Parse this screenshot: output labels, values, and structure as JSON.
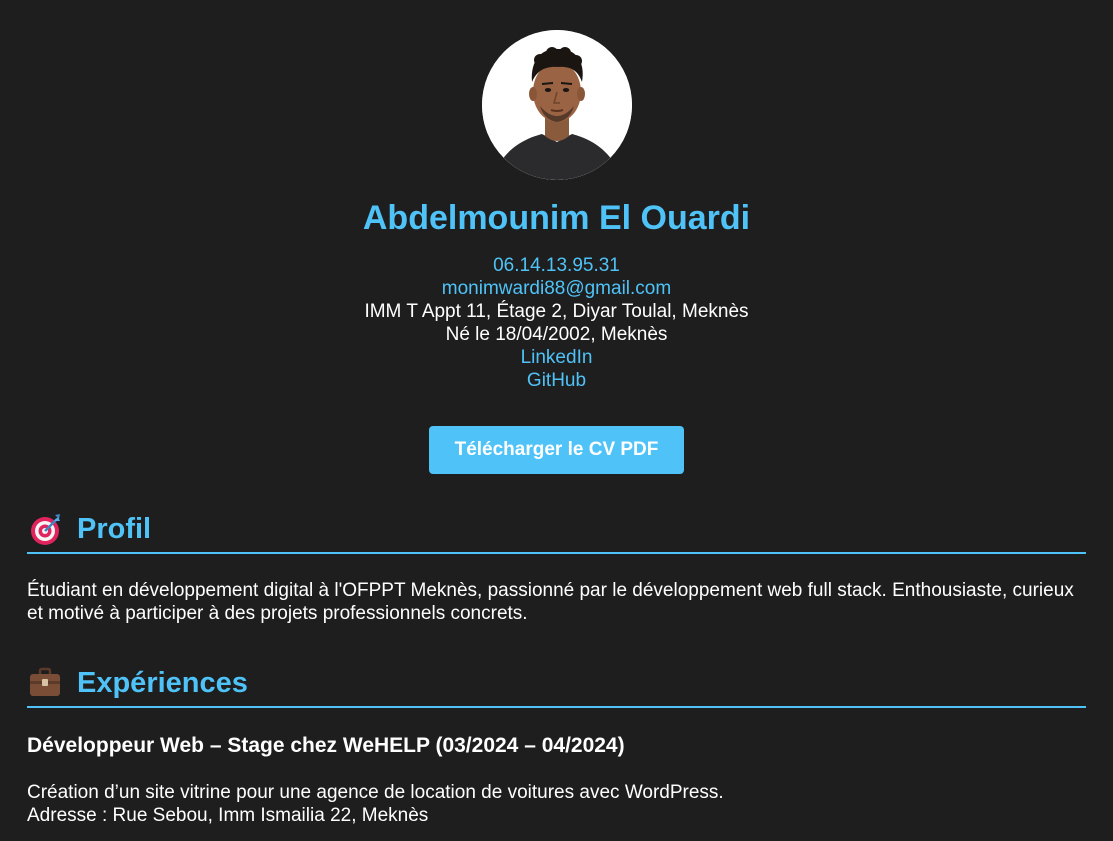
{
  "header": {
    "name": "Abdelmounim El Ouardi",
    "phone": "06.14.13.95.31",
    "email": "monimwardi88@gmail.com",
    "address": "IMM T Appt 11, Étage 2, Diyar Toulal, Meknès",
    "birth": "Né le 18/04/2002, Meknès",
    "linkedin": "LinkedIn",
    "github": "GitHub",
    "download_button": "Télécharger le CV PDF"
  },
  "profil": {
    "icon": "target-icon",
    "title": "Profil",
    "text": "Étudiant en développement digital à l'OFPPT Meknès, passionné par le développement web full stack. Enthousiaste, curieux et motivé à participer à des projets professionnels concrets."
  },
  "experiences": {
    "icon": "briefcase-icon",
    "title": "Expériences",
    "items": [
      {
        "title": "Développeur Web – Stage chez WeHELP (03/2024 – 04/2024)",
        "line1": "Création d’un site vitrine pour une agence de location de voitures avec WordPress.",
        "line2": "Adresse : Rue Sebou, Imm Ismailia 22, Meknès"
      }
    ]
  },
  "colors": {
    "background": "#1e1e1e",
    "accent": "#4fc3f7",
    "text": "#ffffff"
  }
}
